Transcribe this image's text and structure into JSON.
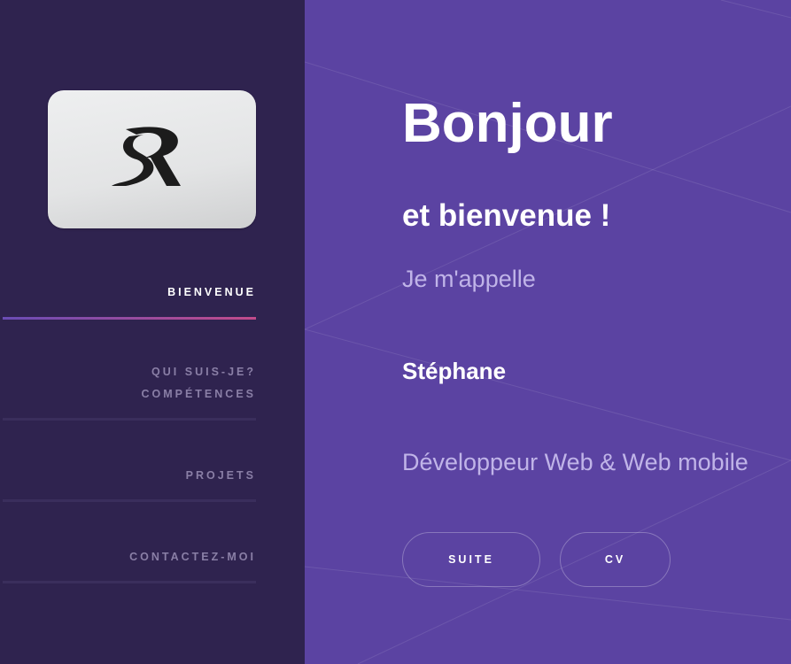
{
  "sidebar": {
    "logo": {
      "icon": "sr-monogram-logo"
    },
    "nav": [
      {
        "label": "BIENVENUE",
        "active": true
      },
      {
        "label": "QUI SUIS-JE?",
        "label2": "COMPÉTENCES",
        "active": false
      },
      {
        "label": "PROJETS",
        "active": false
      },
      {
        "label": "CONTACTEZ-MOI",
        "active": false
      }
    ]
  },
  "hero": {
    "title": "Bonjour",
    "subtitle": "et bienvenue !",
    "intro": "Je m'appelle",
    "name": "Stéphane",
    "role": "Développeur Web & Web mobile",
    "buttons": {
      "suite": "SUITE",
      "cv": "CV"
    }
  },
  "colors": {
    "sidebar_bg": "#2f234f",
    "main_bg": "#5b43a2",
    "accent_gradient_start": "#6a4cb5",
    "accent_gradient_end": "#c24b8b",
    "muted_text": "#c0b4e8"
  }
}
